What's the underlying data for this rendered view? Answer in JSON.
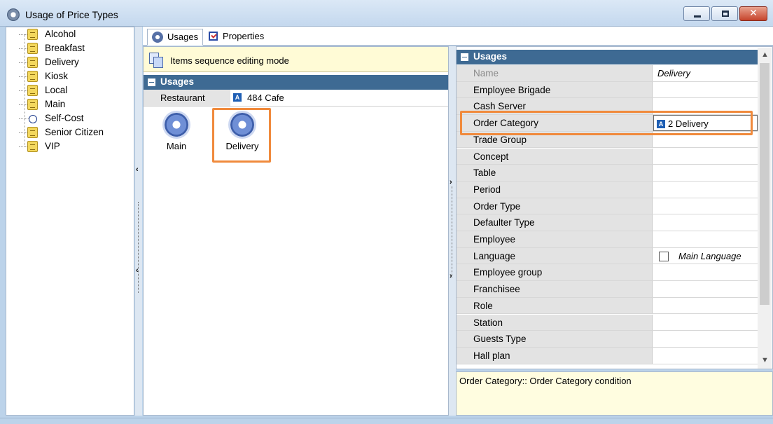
{
  "window": {
    "title": "Usage of Price Types"
  },
  "tree": {
    "items": [
      {
        "label": "Alcohol",
        "icon": "price-type-icon"
      },
      {
        "label": "Breakfast",
        "icon": "price-type-icon"
      },
      {
        "label": "Delivery",
        "icon": "price-type-icon"
      },
      {
        "label": "Kiosk",
        "icon": "price-type-icon"
      },
      {
        "label": "Local",
        "icon": "price-type-icon"
      },
      {
        "label": "Main",
        "icon": "price-type-icon"
      },
      {
        "label": "Self-Cost",
        "icon": "self-cost-icon"
      },
      {
        "label": "Senior Citizen",
        "icon": "price-type-icon"
      },
      {
        "label": "VIP",
        "icon": "price-type-icon"
      }
    ]
  },
  "tabs": {
    "usages": "Usages",
    "properties": "Properties"
  },
  "middle": {
    "sequence_mode": "Items sequence editing mode",
    "section": "Usages",
    "restaurant_label": "Restaurant",
    "restaurant_value": "484 Cafe",
    "tiles": [
      {
        "label": "Main"
      },
      {
        "label": "Delivery"
      }
    ]
  },
  "grid": {
    "section": "Usages",
    "rows": [
      {
        "name": "Name",
        "value": "Delivery"
      },
      {
        "name": "Employee Brigade",
        "value": ""
      },
      {
        "name": "Cash Server",
        "value": ""
      },
      {
        "name": "Order Category",
        "value": "2 Delivery"
      },
      {
        "name": "Trade Group",
        "value": ""
      },
      {
        "name": "Concept",
        "value": ""
      },
      {
        "name": "Table",
        "value": ""
      },
      {
        "name": "Period",
        "value": ""
      },
      {
        "name": "Order Type",
        "value": ""
      },
      {
        "name": "Defaulter Type",
        "value": ""
      },
      {
        "name": "Employee",
        "value": ""
      },
      {
        "name": "Language",
        "value": "Main Language"
      },
      {
        "name": "Employee group",
        "value": ""
      },
      {
        "name": "Franchisee",
        "value": ""
      },
      {
        "name": "Role",
        "value": ""
      },
      {
        "name": "Station",
        "value": ""
      },
      {
        "name": "Guests Type",
        "value": ""
      },
      {
        "name": "Hall plan",
        "value": ""
      }
    ]
  },
  "description": "Order Category:: Order Category condition",
  "colors": {
    "section_header": "#3e6a93",
    "highlight": "#f08a3c",
    "info_bg": "#fffbd6"
  }
}
